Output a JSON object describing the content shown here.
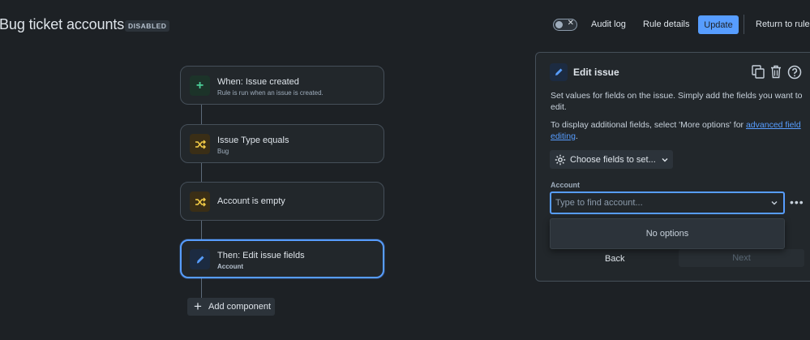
{
  "header": {
    "title": "Bug ticket accounts",
    "status_badge": "DISABLED",
    "toggle_symbol": "✕",
    "audit_log": "Audit log",
    "rule_details": "Rule details",
    "update": "Update",
    "return_to_rules": "Return to rules"
  },
  "flow": {
    "components": [
      {
        "title": "When: Issue created",
        "subtitle": "Rule is run when an issue is created.",
        "icon": "plus-icon",
        "color": "#4bce97"
      },
      {
        "title": "Issue Type equals",
        "subtitle": "Bug",
        "icon": "shuffle-icon",
        "color": "#f5cd47"
      },
      {
        "title": "Account is empty",
        "subtitle": "",
        "icon": "shuffle-icon",
        "color": "#f5cd47"
      },
      {
        "title": "Then: Edit issue fields",
        "subtitle": "Account",
        "icon": "pencil-icon",
        "color": "#579dff"
      }
    ],
    "add_component": "Add component"
  },
  "panel": {
    "title": "Edit issue",
    "description": "Set values for fields on the issue. Simply add the fields you want to edit.",
    "more_prefix": "To display additional fields, select 'More options' for ",
    "more_link": "advanced field editing",
    "more_suffix": ".",
    "choose_fields": "Choose fields to set...",
    "account_label": "Account",
    "account_placeholder": "Type to find account...",
    "no_options": "No options",
    "back": "Back",
    "next": "Next"
  },
  "colors": {
    "background": "#1d2125",
    "accent": "#579dff",
    "card": "#22272b"
  }
}
